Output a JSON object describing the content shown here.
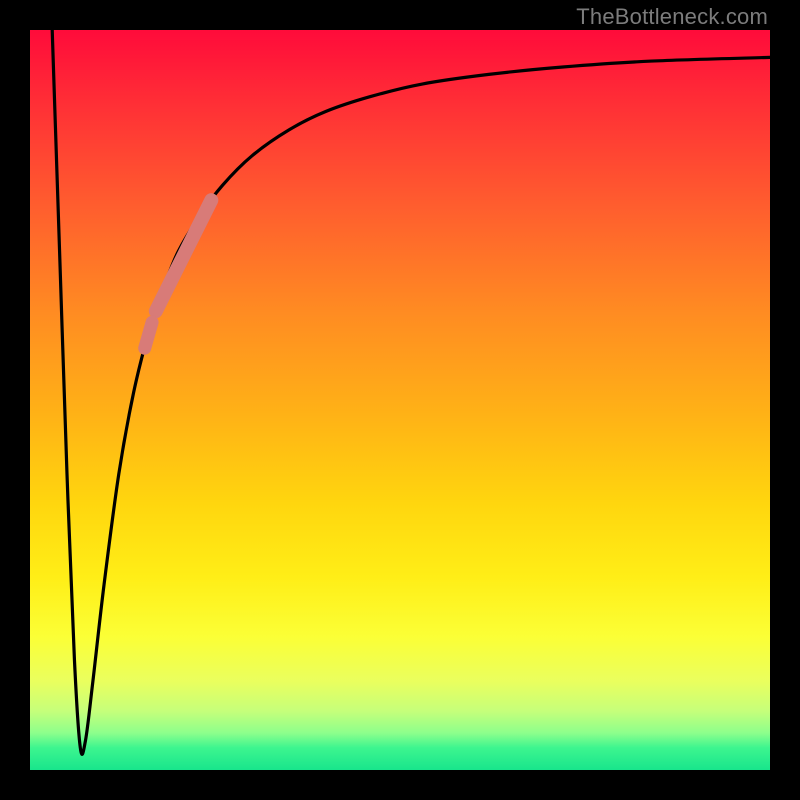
{
  "watermark": "TheBottleneck.com",
  "chart_data": {
    "type": "line",
    "title": "",
    "xlabel": "",
    "ylabel": "",
    "xlim": [
      0,
      100
    ],
    "ylim": [
      0,
      100
    ],
    "grid": false,
    "legend": false,
    "series": [
      {
        "name": "bottleneck-curve",
        "x": [
          3,
          4,
          5,
          6,
          6.8,
          7.5,
          8.5,
          10,
          12,
          14,
          16,
          18,
          20,
          23,
          26,
          30,
          35,
          40,
          46,
          53,
          62,
          72,
          84,
          100
        ],
        "y": [
          100,
          70,
          40,
          15,
          3,
          4,
          12,
          25,
          40,
          51,
          59,
          65,
          70,
          75,
          79,
          83,
          86.5,
          89,
          91,
          92.7,
          94,
          95,
          95.8,
          96.3
        ]
      },
      {
        "name": "highlight-upper",
        "x": [
          17,
          24.5
        ],
        "y": [
          62,
          77
        ]
      },
      {
        "name": "highlight-lower",
        "x": [
          15.5,
          16.5
        ],
        "y": [
          57,
          60.5
        ]
      }
    ],
    "colors": {
      "curve": "#000000",
      "highlight": "#d87b78"
    }
  }
}
